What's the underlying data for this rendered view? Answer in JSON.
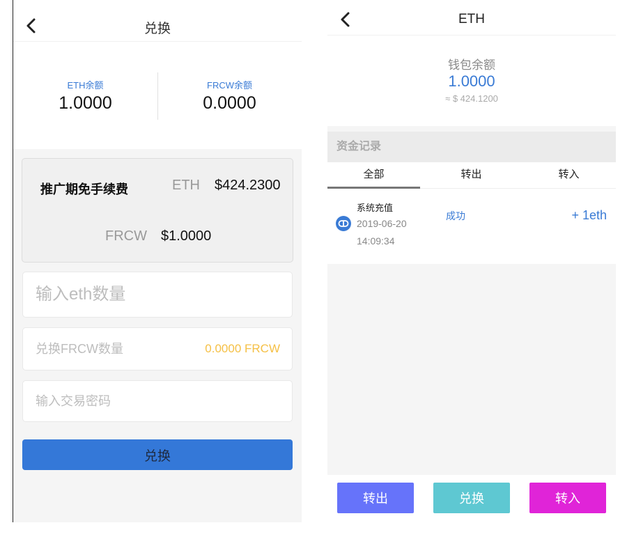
{
  "exchange_screen": {
    "title": "兑换",
    "eth_balance_label": "ETH余额",
    "eth_balance_value": "1.0000",
    "frcw_balance_label": "FRCW余额",
    "frcw_balance_value": "0.0000",
    "promo": {
      "title": "推广期免手续费",
      "eth_label": "ETH",
      "eth_price": "$424.2300",
      "frcw_label": "FRCW",
      "frcw_price": "$1.0000"
    },
    "eth_amount_placeholder": "输入eth数量",
    "frcw_amount_placeholder": "兑换FRCW数量",
    "frcw_amount_value": "0.0000 FRCW",
    "password_placeholder": "输入交易密码",
    "submit_label": "兑换",
    "submit_color": "#3478d8"
  },
  "wallet_screen": {
    "title": "ETH",
    "balance_label": "钱包余额",
    "balance_value": "1.0000",
    "balance_usd": "≈ $ 424.1200",
    "records_title": "资金记录",
    "tabs": [
      {
        "label": "全部",
        "active": true
      },
      {
        "label": "转出",
        "active": false
      },
      {
        "label": "转入",
        "active": false
      }
    ],
    "records": [
      {
        "icon": "deposit-icon",
        "name": "系统充值",
        "date": "2019-06-20",
        "time": "14:09:34",
        "status": "成功",
        "amount": "+ 1eth"
      }
    ],
    "buttons": [
      {
        "label": "转出",
        "color": "#6673fa"
      },
      {
        "label": "兑换",
        "color": "#5ec8d2"
      },
      {
        "label": "转入",
        "color": "#e024d8"
      }
    ]
  },
  "colors": {
    "accent_blue": "#3a7bd5",
    "frcw_amount": "#f5c046"
  }
}
